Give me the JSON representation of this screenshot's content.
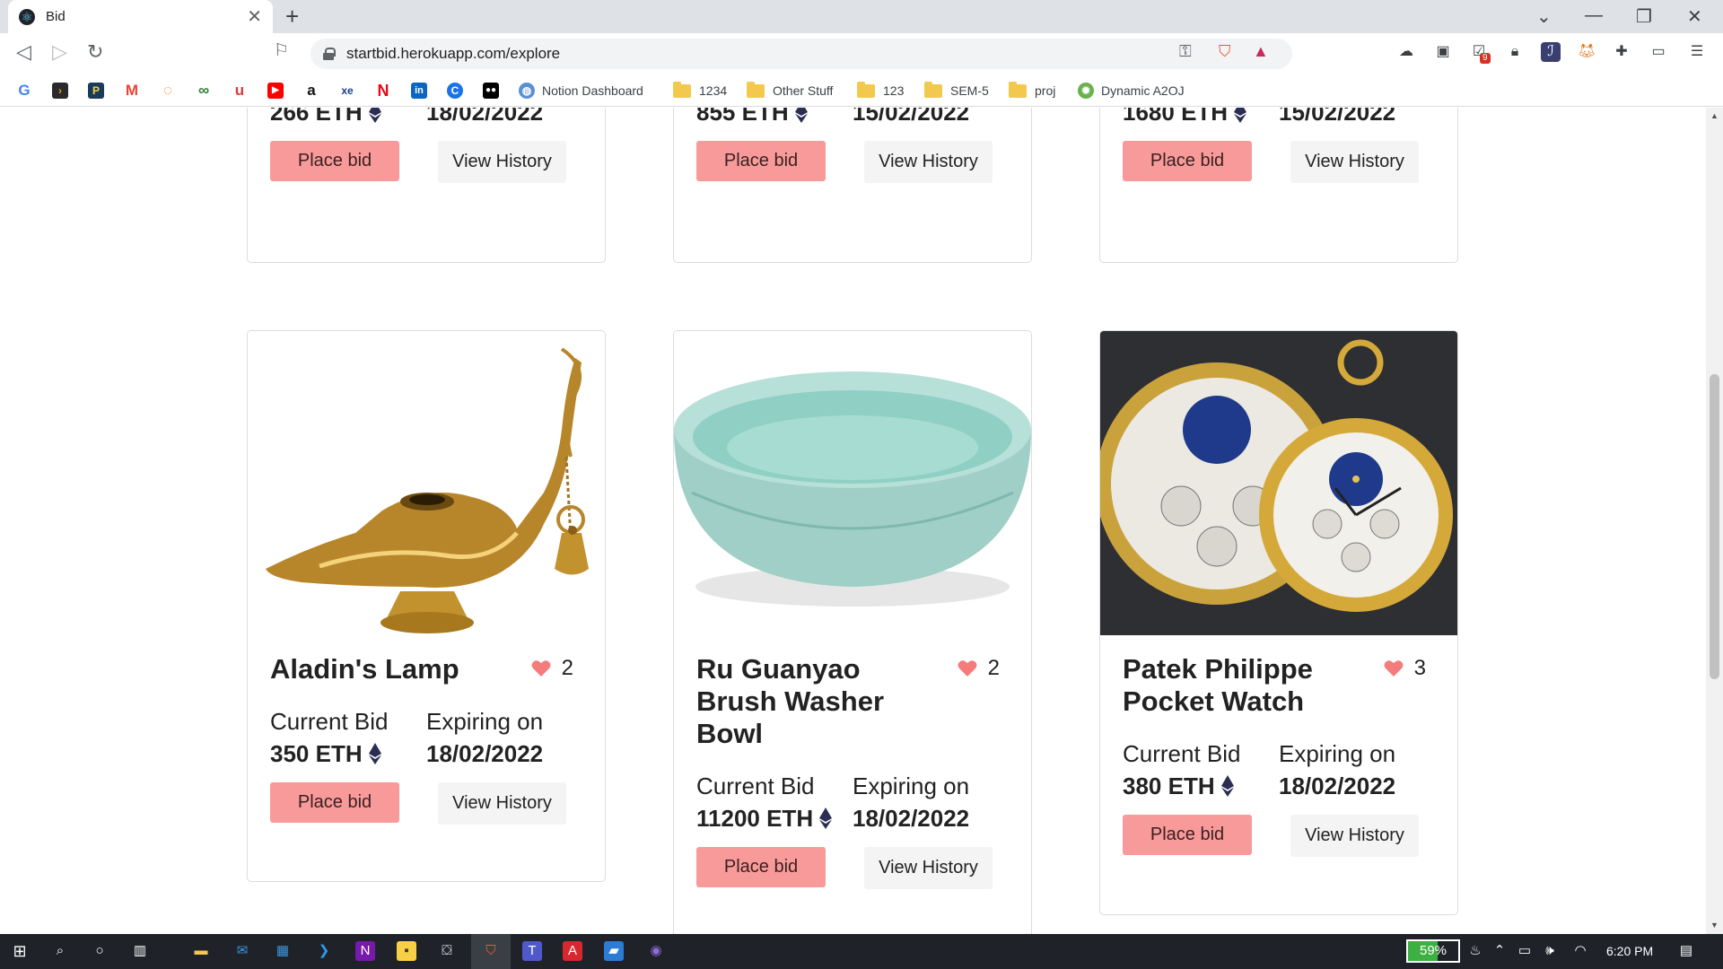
{
  "browser": {
    "tab_title": "Bid",
    "url": "startbid.herokuapp.com/explore",
    "extension_badge": "9",
    "bookmarks": [
      {
        "label": "Notion Dashboard",
        "type": "site"
      },
      {
        "label": "1234",
        "type": "folder"
      },
      {
        "label": "Other Stuff",
        "type": "folder"
      },
      {
        "label": "123",
        "type": "folder"
      },
      {
        "label": "SEM-5",
        "type": "folder"
      },
      {
        "label": "proj",
        "type": "folder"
      },
      {
        "label": "Dynamic A2OJ",
        "type": "site"
      }
    ]
  },
  "labels": {
    "current_bid": "Current Bid",
    "expiring_on": "Expiring on",
    "place_bid": "Place bid",
    "view_history": "View History"
  },
  "top_cards": [
    {
      "bid": "266 ETH",
      "expires": "18/02/2022"
    },
    {
      "bid": "855 ETH",
      "expires": "15/02/2022"
    },
    {
      "bid": "1680 ETH",
      "expires": "15/02/2022"
    }
  ],
  "cards": [
    {
      "title": "Aladin's Lamp",
      "likes": "2",
      "bid": "350 ETH",
      "expires": "18/02/2022"
    },
    {
      "title": "Ru Guanyao Brush Washer Bowl",
      "likes": "2",
      "bid": "11200 ETH",
      "expires": "18/02/2022"
    },
    {
      "title": "Patek Philippe Pocket Watch",
      "likes": "3",
      "bid": "380 ETH",
      "expires": "18/02/2022"
    }
  ],
  "colors": {
    "accent_button": "#f99a9a",
    "heart": "#f47c7c",
    "eth": "#2b2d52"
  },
  "taskbar": {
    "battery": "59%",
    "time": "6:20 PM"
  }
}
